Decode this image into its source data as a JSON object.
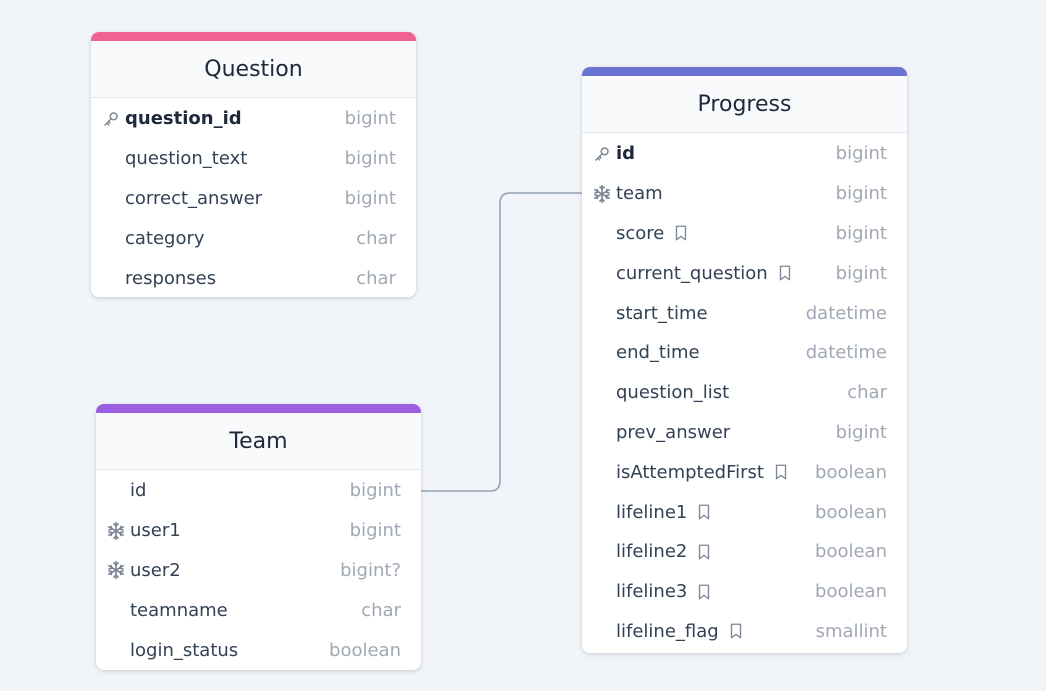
{
  "colors": {
    "question": "#f06292",
    "team": "#9c5fe0",
    "progress": "#6a72d2",
    "connector": "#94a3b8",
    "icon": "#7c8796"
  },
  "tables": {
    "question": {
      "title": "Question",
      "fields": [
        {
          "name": "question_id",
          "type": "bigint",
          "icon": "key-icon",
          "pk": true,
          "note": false
        },
        {
          "name": "question_text",
          "type": "bigint",
          "icon": "",
          "pk": false,
          "note": false
        },
        {
          "name": "correct_answer",
          "type": "bigint",
          "icon": "",
          "pk": false,
          "note": false
        },
        {
          "name": "category",
          "type": "char",
          "icon": "",
          "pk": false,
          "note": false
        },
        {
          "name": "responses",
          "type": "char",
          "icon": "",
          "pk": false,
          "note": false
        }
      ]
    },
    "team": {
      "title": "Team",
      "fields": [
        {
          "name": "id",
          "type": "bigint",
          "icon": "",
          "pk": false,
          "note": false
        },
        {
          "name": "user1",
          "type": "bigint",
          "icon": "snowflake-icon",
          "pk": false,
          "note": false
        },
        {
          "name": "user2",
          "type": "bigint?",
          "icon": "snowflake-icon",
          "pk": false,
          "note": false
        },
        {
          "name": "teamname",
          "type": "char",
          "icon": "",
          "pk": false,
          "note": false
        },
        {
          "name": "login_status",
          "type": "boolean",
          "icon": "",
          "pk": false,
          "note": false
        }
      ]
    },
    "progress": {
      "title": "Progress",
      "fields": [
        {
          "name": "id",
          "type": "bigint",
          "icon": "key-icon",
          "pk": true,
          "note": false
        },
        {
          "name": "team",
          "type": "bigint",
          "icon": "snowflake-icon",
          "pk": false,
          "note": false
        },
        {
          "name": "score",
          "type": "bigint",
          "icon": "",
          "pk": false,
          "note": true
        },
        {
          "name": "current_question",
          "type": "bigint",
          "icon": "",
          "pk": false,
          "note": true
        },
        {
          "name": "start_time",
          "type": "datetime",
          "icon": "",
          "pk": false,
          "note": false
        },
        {
          "name": "end_time",
          "type": "datetime",
          "icon": "",
          "pk": false,
          "note": false
        },
        {
          "name": "question_list",
          "type": "char",
          "icon": "",
          "pk": false,
          "note": false
        },
        {
          "name": "prev_answer",
          "type": "bigint",
          "icon": "",
          "pk": false,
          "note": false
        },
        {
          "name": "isAttemptedFirst",
          "type": "boolean",
          "icon": "",
          "pk": false,
          "note": true
        },
        {
          "name": "lifeline1",
          "type": "boolean",
          "icon": "",
          "pk": false,
          "note": true
        },
        {
          "name": "lifeline2",
          "type": "boolean",
          "icon": "",
          "pk": false,
          "note": true
        },
        {
          "name": "lifeline3",
          "type": "boolean",
          "icon": "",
          "pk": false,
          "note": true
        },
        {
          "name": "lifeline_flag",
          "type": "smallint",
          "icon": "",
          "pk": false,
          "note": true
        }
      ]
    }
  },
  "relationships": [
    {
      "from": "team.id",
      "to": "progress.team"
    }
  ]
}
